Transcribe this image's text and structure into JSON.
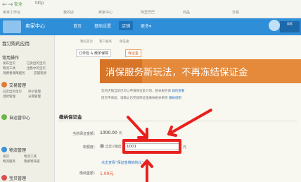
{
  "browser": {
    "back": "←",
    "forward": "→",
    "secure": "安全",
    "url": "http",
    "bookmarks": [
      "卖家工作台",
      "我的店",
      "卖家中心",
      "阿里巴巴",
      "商品",
      "交易"
    ]
  },
  "header": {
    "brand": "卖家中心",
    "nav": [
      "首页",
      "基础设置",
      "店铺",
      "更多"
    ],
    "more_arrow": "▾",
    "corner_text": "商家"
  },
  "sidebar": {
    "title": "我订购的应用",
    "sections": [
      {
        "title": "常用操作",
        "links": [
          "发布宝贝",
          "已卖出的宝贝",
          "物流工具",
          "出售中的宝贝",
          "消费者保障服务",
          "店铺装修"
        ]
      },
      {
        "title": "交易管理",
        "links": [
          "已卖出的宝贝",
          "评价管理",
          "退款管理",
          "分期管理"
        ]
      },
      {
        "title": "自运营中心",
        "links": []
      },
      {
        "title": "物流管理",
        "links": [
          "发货",
          "物流工具",
          "物流服务",
          "我要寄快递"
        ]
      },
      {
        "title": "宝贝管理",
        "links": []
      }
    ]
  },
  "content": {
    "breadcrumb": [
      "我的首页",
      "客户服务",
      "保证金"
    ],
    "tabs": [
      "订单险 & 散单保障",
      "保证金"
    ],
    "banner_text": "消保服务新玩法，不再冻结保证金",
    "notice_lines": [
      "您的店铺当前已可以申请保证金计划，相关服务请",
      "提交申请前，请确认已完成保证金缴纳相关事项"
    ],
    "notice_links": [
      "如何查看",
      "缴纳说明"
    ],
    "section_title": "缴纳保证金",
    "fields": {
      "current_label": "当前保证金额：",
      "current_value": "1000.00",
      "current_unit": "元",
      "new_label": "新额度：",
      "custom_label": "自定义额度",
      "amount_value": "1001",
      "amount_unit": "元",
      "agree_link": "点击查看“保证金缴纳协议”",
      "pay_label": "缴纳金额：",
      "pay_value": "1.00元"
    }
  },
  "colors": {
    "header_blue": "#2f8ed8",
    "banner_orange": "#e5893a",
    "annotation_red": "#e8201e"
  }
}
